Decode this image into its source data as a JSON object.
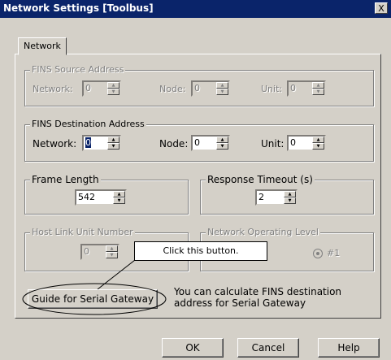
{
  "window": {
    "title": "Network Settings [Toolbus]",
    "close_glyph": "X"
  },
  "tabs": [
    {
      "label": "Network"
    }
  ],
  "fins_source": {
    "legend": "FINS Source Address",
    "network_label": "Network:",
    "network_value": "0",
    "node_label": "Node:",
    "node_value": "0",
    "unit_label": "Unit:",
    "unit_value": "0"
  },
  "fins_dest": {
    "legend": "FINS Destination Address",
    "network_label": "Network:",
    "network_value": "0",
    "node_label": "Node:",
    "node_value": "0",
    "unit_label": "Unit:",
    "unit_value": "0"
  },
  "frame_length": {
    "legend": "Frame Length",
    "value": "542"
  },
  "response_timeout": {
    "legend": "Response Timeout (s)",
    "value": "2"
  },
  "host_link": {
    "legend": "Host Link Unit Number",
    "value": "0"
  },
  "network_level": {
    "legend": "Network Operating Level",
    "option": "#1"
  },
  "callout": {
    "text": "Click this button."
  },
  "gateway": {
    "button_label": "Guide for Serial Gateway",
    "hint_line1": "You can calculate FINS destination",
    "hint_line2": "address for Serial Gateway"
  },
  "buttons": {
    "ok": "OK",
    "cancel": "Cancel",
    "help": "Help"
  }
}
